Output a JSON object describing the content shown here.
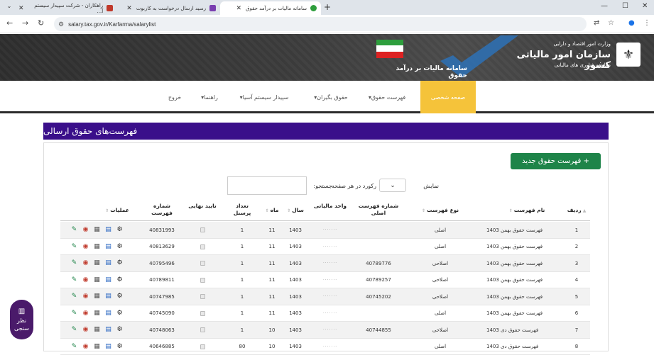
{
  "browser": {
    "tabs": [
      {
        "title": "سامانه مالیات بر درآمد حقوق",
        "active": true
      },
      {
        "title": "رسید ارسال درخواست به کاربوت",
        "active": false
      },
      {
        "title": "راهکاران - شرکت سپیدار سیستم آ...",
        "active": false
      }
    ],
    "url": "salary.tax.gov.ir/Karfarma/salarylist",
    "new_tab": "+",
    "minimize": "—",
    "maximize": "☐",
    "close": "✕"
  },
  "header": {
    "org_line1": "وزارت امور اقتصاد و دارایی",
    "org_name": "سازمان امور مالیاتی کشور",
    "org_line3": "معاونت فناوری های مالیاتی",
    "system_title": "سامانه مالیات بر درآمد حقوق"
  },
  "nav": {
    "items": [
      {
        "label": "صفحه شخصی",
        "active": true
      },
      {
        "label": "فهرست حقوق▾",
        "active": false
      },
      {
        "label": "حقوق بگیران▾",
        "active": false
      },
      {
        "label": "سپیدار سیستم آسیا▾",
        "active": false
      },
      {
        "label": "راهنما▾",
        "active": false
      },
      {
        "label": "خروج",
        "active": false
      }
    ]
  },
  "page": {
    "title": "فهرست‌های حقوق ارسالی",
    "new_button": "+ فهرست حقوق جدید",
    "show_label": "نمایش",
    "show_value": "",
    "per_page_label": "رکورد در هر صفحه",
    "search_label": "جستجو:"
  },
  "table": {
    "headers": {
      "idx": "ردیف",
      "name": "نام فهرست",
      "type": "نوع فهرست",
      "orig": "شماره فهرست اصلی",
      "unit": "واحد مالیاتی",
      "year": "سال",
      "month": "ماه",
      "count": "تعداد پرسنل",
      "final": "تایید نهایی",
      "num": "شماره فهرست",
      "ops": "عملیات"
    },
    "rows": [
      {
        "idx": "1",
        "name": "فهرست حقوق بهمن 1403",
        "type": "اصلی",
        "orig": "",
        "unit": "·······",
        "year": "1403",
        "month": "11",
        "count": "1",
        "num": "40831993"
      },
      {
        "idx": "2",
        "name": "فهرست حقوق بهمن 1403",
        "type": "اصلی",
        "orig": "",
        "unit": "·······",
        "year": "1403",
        "month": "11",
        "count": "1",
        "num": "40813629"
      },
      {
        "idx": "3",
        "name": "فهرست حقوق بهمن 1403",
        "type": "اصلاحی",
        "orig": "40789776",
        "unit": "·······",
        "year": "1403",
        "month": "11",
        "count": "1",
        "num": "40795496"
      },
      {
        "idx": "4",
        "name": "فهرست حقوق بهمن 1403",
        "type": "اصلاحی",
        "orig": "40789257",
        "unit": "·······",
        "year": "1403",
        "month": "11",
        "count": "1",
        "num": "40789811"
      },
      {
        "idx": "5",
        "name": "فهرست حقوق بهمن 1403",
        "type": "اصلاحی",
        "orig": "40745202",
        "unit": "·······",
        "year": "1403",
        "month": "11",
        "count": "1",
        "num": "40747985"
      },
      {
        "idx": "6",
        "name": "فهرست حقوق بهمن 1403",
        "type": "اصلی",
        "orig": "",
        "unit": "·······",
        "year": "1403",
        "month": "11",
        "count": "1",
        "num": "40745090"
      },
      {
        "idx": "7",
        "name": "فهرست حقوق دی 1403",
        "type": "اصلاحی",
        "orig": "40744855",
        "unit": "·······",
        "year": "1403",
        "month": "10",
        "count": "1",
        "num": "40748063"
      },
      {
        "idx": "8",
        "name": "فهرست حقوق دی 1403",
        "type": "اصلی",
        "orig": "",
        "unit": "·······",
        "year": "1403",
        "month": "10",
        "count": "80",
        "num": "40646885"
      }
    ]
  },
  "poll": {
    "line1": "نظر",
    "line2": "سنجی"
  }
}
